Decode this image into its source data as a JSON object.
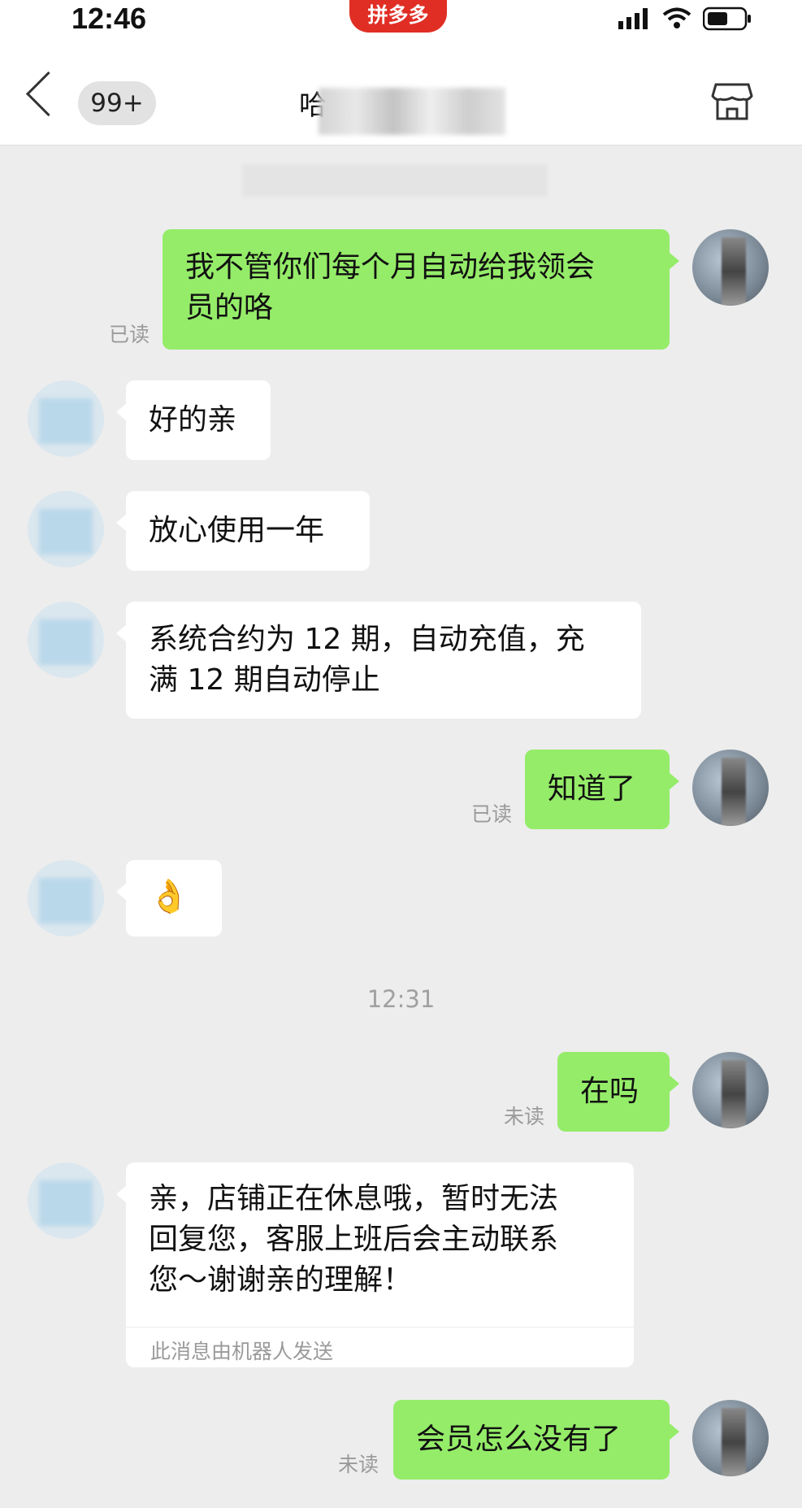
{
  "status_bar": {
    "time": "12:46",
    "app_badge": "拼多多"
  },
  "nav": {
    "badge": "99+",
    "title_visible": "哈"
  },
  "messages": [
    {
      "from": "me",
      "text_line1": "我不管你们每个月自动给我领会",
      "text_line2": "员的咯",
      "status": "已读"
    },
    {
      "from": "shop",
      "text": "好的亲"
    },
    {
      "from": "shop",
      "text": "放心使用一年"
    },
    {
      "from": "shop",
      "text_line1": "系统合约为 12 期，自动充值，充",
      "text_line2": "满 12 期自动停止"
    },
    {
      "from": "me",
      "text": "知道了",
      "status": "已读"
    },
    {
      "from": "shop",
      "emoji": "👌"
    },
    {
      "from": "me",
      "text": "在吗",
      "status": "未读"
    },
    {
      "from": "shop",
      "text_line1": "亲，店铺正在休息哦，暂时无法",
      "text_line2": "回复您，客服上班后会主动联系",
      "text_line3": "您～谢谢亲的理解！",
      "note": "此消息由机器人发送"
    },
    {
      "from": "me",
      "text": "会员怎么没有了",
      "status": "未读"
    }
  ],
  "timestamp": "12:31",
  "colors": {
    "me_bubble": "#95ec69",
    "shop_bubble": "#ffffff",
    "background": "#ededed",
    "pdd_red": "#e02e24"
  }
}
